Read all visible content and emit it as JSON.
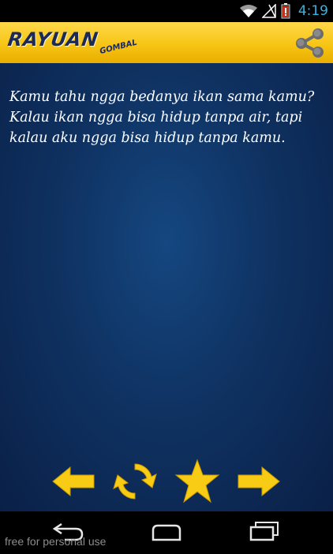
{
  "status_bar": {
    "time": "4:19",
    "icons": [
      "wifi-icon",
      "signal-icon",
      "battery-icon"
    ],
    "clock_color": "#33b5e5"
  },
  "app_bar": {
    "logo_text": "RAYUAN",
    "logo_subtext": "GOMBAL",
    "share_icon": "share-icon",
    "background_color": "#f7c515"
  },
  "main": {
    "quote": "Kamu tahu ngga bedanya ikan sama kamu? Kalau ikan ngga bisa hidup tanpa air, tapi kalau aku ngga bisa hidup tanpa kamu."
  },
  "controls": {
    "items": [
      "arrow-left-icon",
      "refresh-icon",
      "star-icon",
      "arrow-right-icon"
    ],
    "icon_color": "#f8cb14"
  },
  "nav_bar": {
    "items": [
      "back-icon",
      "home-icon",
      "recent-apps-icon"
    ]
  },
  "watermark": "free for personal use"
}
